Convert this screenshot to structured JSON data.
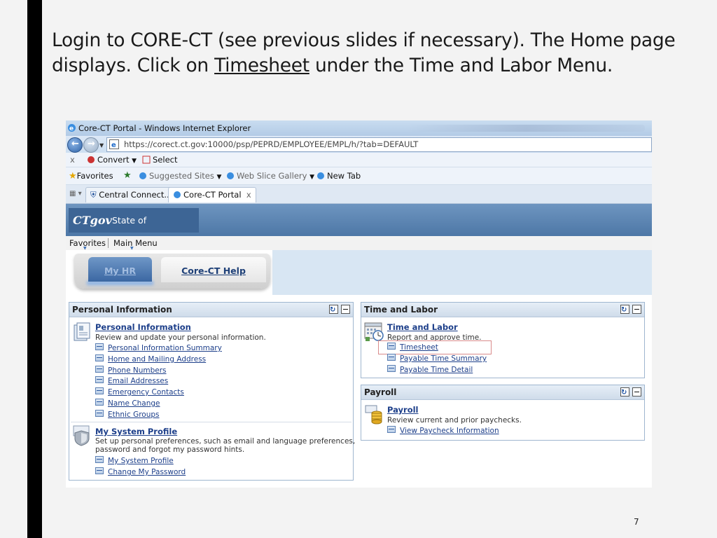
{
  "slide": {
    "title_part1": "Login to CORE-CT (see previous slides if necessary).  The Home page displays. Click on ",
    "title_link": "Timesheet",
    "title_part2": " under the Time and Labor Menu.",
    "page_number": "7"
  },
  "browser": {
    "window_title": "Core-CT Portal - Windows Internet Explorer",
    "url": "https://corect.ct.gov:10000/psp/PEPRD/EMPLOYEE/EMPL/h/?tab=DEFAULT",
    "command_bar": {
      "close": "x",
      "convert": "Convert",
      "select": "Select"
    },
    "favorites_bar": {
      "favorites": "Favorites",
      "items": [
        "Suggested Sites",
        "Web Slice Gallery",
        "New Tab"
      ]
    },
    "tabs": [
      {
        "label": "Central Connect...",
        "active": false
      },
      {
        "label": "Core-CT Portal",
        "active": true,
        "close": "x"
      }
    ]
  },
  "portal": {
    "logo_mark": "CTgov",
    "logo_text": "State of Connecticut",
    "menu": [
      "Favorites",
      "Main Menu"
    ],
    "home_tabs": [
      "My HR",
      "Core-CT Help"
    ]
  },
  "pagelets": {
    "personal": {
      "title": "Personal Information",
      "groups": [
        {
          "title": "Personal Information",
          "desc": [
            "Review and update your personal information."
          ],
          "links": [
            "Personal Information Summary",
            "Home and Mailing Address",
            "Phone Numbers",
            "Email Addresses",
            "Emergency Contacts",
            "Name Change",
            "Ethnic Groups"
          ]
        },
        {
          "title": "My System Profile",
          "desc": [
            "Set up personal preferences, such as email and language preferences,",
            "password and forgot my password hints."
          ],
          "links": [
            "My System Profile",
            "Change My Password"
          ]
        }
      ]
    },
    "time_labor": {
      "title": "Time and Labor",
      "group_title": "Time and Labor",
      "desc": "Report and approve time.",
      "links": [
        "Timesheet",
        "Payable Time Summary",
        "Payable Time Detail"
      ],
      "highlighted": "Timesheet"
    },
    "payroll": {
      "title": "Payroll",
      "group_title": "Payroll",
      "desc": "Review current and prior paychecks.",
      "links": [
        "View Paycheck Information"
      ]
    }
  },
  "colors": {
    "link": "#1d3f8a",
    "header_blue": "#4d77a6",
    "highlight_box": "#d98c8c"
  }
}
